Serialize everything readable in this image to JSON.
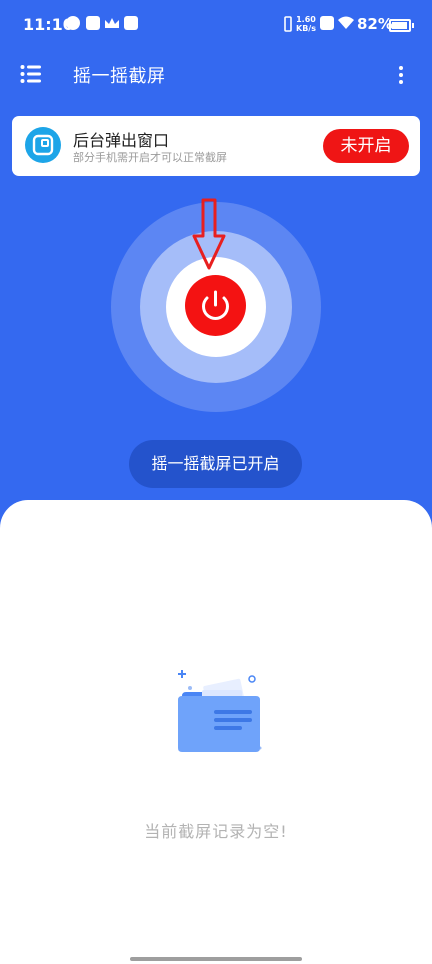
{
  "status_bar": {
    "time": "11:10",
    "net_speed_value": "1.60",
    "net_speed_unit": "KB/s",
    "battery": "82%"
  },
  "appbar": {
    "title": "摇一摇截屏",
    "menu_icon": "list-menu-icon",
    "more_icon": "more-vertical-icon"
  },
  "popup_card": {
    "title": "后台弹出窗口",
    "subtitle": "部分手机需开启才可以正常截屏",
    "button_label": "未开启",
    "icon": "popup-window-icon"
  },
  "power": {
    "icon": "power-icon",
    "arrow_icon": "down-arrow-annotation-icon"
  },
  "shake_status_label": "摇一摇截屏已开启",
  "empty_state": {
    "text": "当前截屏记录为空!",
    "icon": "empty-folder-illustration"
  },
  "colors": {
    "primary_blue": "#3469f0",
    "accent_red": "#ef1515",
    "card_icon_blue": "#1da5e8"
  }
}
